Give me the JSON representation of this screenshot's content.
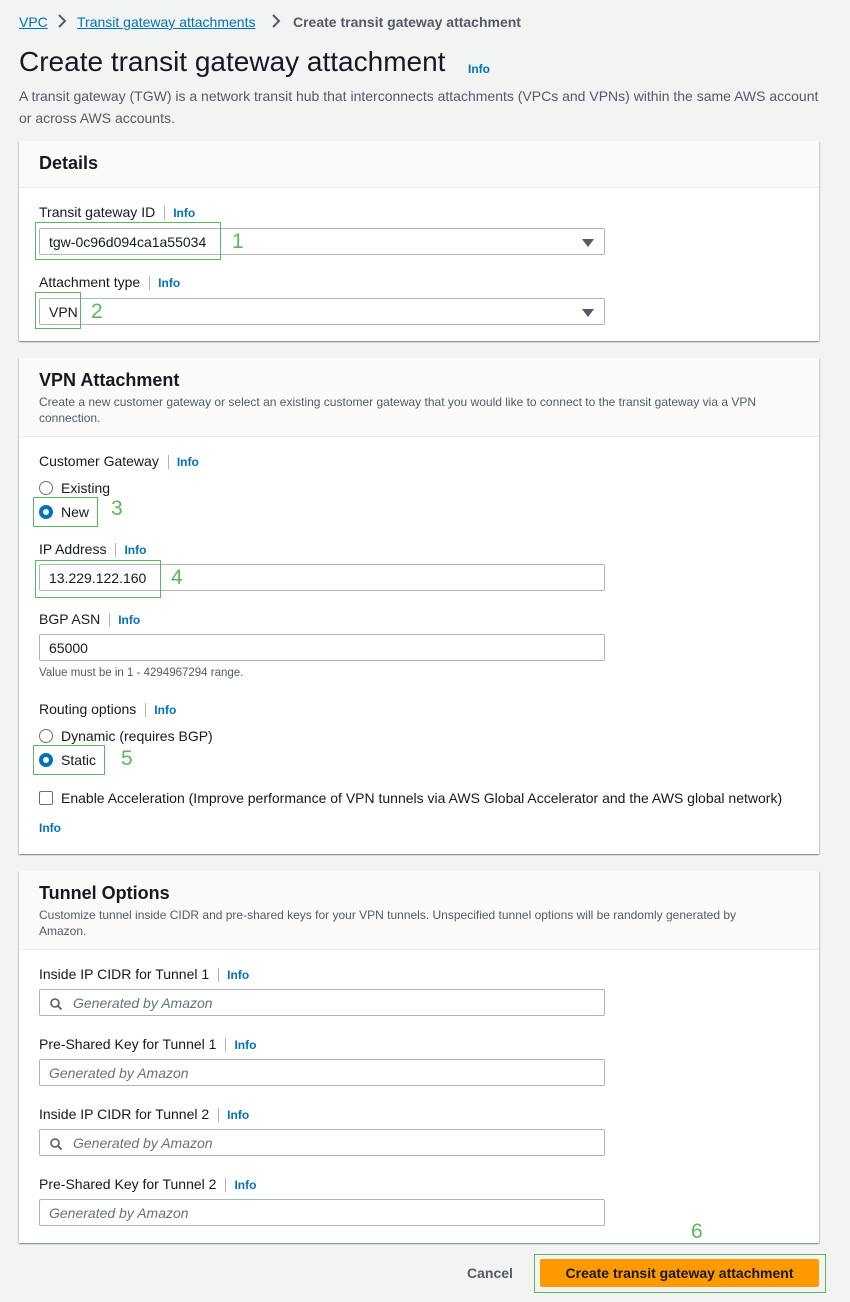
{
  "breadcrumb": {
    "items": [
      "VPC",
      "Transit gateway attachments"
    ],
    "current": "Create transit gateway attachment"
  },
  "page": {
    "title": "Create transit gateway attachment",
    "info": "Info",
    "description": "A transit gateway (TGW) is a network transit hub that interconnects attachments (VPCs and VPNs) within the same AWS account or across AWS accounts."
  },
  "details": {
    "title": "Details",
    "tgw_label": "Transit gateway ID",
    "tgw_value": "tgw-0c96d094ca1a55034",
    "attach_label": "Attachment type",
    "attach_value": "VPN",
    "info": "Info"
  },
  "vpn": {
    "title": "VPN Attachment",
    "description": "Create a new customer gateway or select an existing customer gateway that you would like to connect to the transit gateway via a VPN connection.",
    "cgw_label": "Customer Gateway",
    "cgw_options": [
      "Existing",
      "New"
    ],
    "cgw_selected": "New",
    "ip_label": "IP Address",
    "ip_value": "13.229.122.160",
    "asn_label": "BGP ASN",
    "asn_value": "65000",
    "asn_hint": "Value must be in 1 - 4294967294 range.",
    "routing_label": "Routing options",
    "routing_options": [
      "Dynamic (requires BGP)",
      "Static"
    ],
    "routing_selected": "Static",
    "accel_label": "Enable Acceleration (Improve performance of VPN tunnels via AWS Global Accelerator and the AWS global network)",
    "accel_checked": false,
    "info": "Info"
  },
  "tunnel": {
    "title": "Tunnel Options",
    "description": "Customize tunnel inside CIDR and pre-shared keys for your VPN tunnels. Unspecified tunnel options will be randomly generated by Amazon.",
    "cidr1_label": "Inside IP CIDR for Tunnel 1",
    "psk1_label": "Pre-Shared Key for Tunnel 1",
    "cidr2_label": "Inside IP CIDR for Tunnel 2",
    "psk2_label": "Pre-Shared Key for Tunnel 2",
    "placeholder": "Generated by Amazon",
    "info": "Info"
  },
  "footer": {
    "cancel": "Cancel",
    "submit": "Create transit gateway attachment"
  },
  "annotations": [
    "1",
    "2",
    "3",
    "4",
    "5",
    "6"
  ],
  "colors": {
    "accent": "#0073bb",
    "primary_button": "#ff9900",
    "annotation": "#5cb85c"
  },
  "icons": [
    "chevron-right-icon",
    "caret-down-icon",
    "search-icon"
  ]
}
